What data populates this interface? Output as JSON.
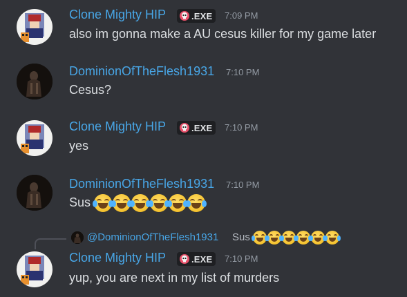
{
  "colors": {
    "background": "#313338",
    "username": "#48a6e6",
    "timestamp": "#949ba4",
    "message_text": "#dbdee1",
    "tag_background": "#1e1f22"
  },
  "messages": [
    {
      "author": "Clone Mighty HIP",
      "tag": ".EXE",
      "tag_icon": "skull-icon",
      "time": "7:09 PM",
      "text": "also im gonna make a AU cesus killer for my game later"
    },
    {
      "author": "DominionOfTheFlesh1931",
      "time": "7:10 PM",
      "text": "Cesus?"
    },
    {
      "author": "Clone Mighty HIP",
      "tag": ".EXE",
      "tag_icon": "skull-icon",
      "time": "7:10 PM",
      "text": "yes"
    },
    {
      "author": "DominionOfTheFlesh1931",
      "time": "7:10 PM",
      "text": "Sus",
      "emoji": "joy-emoji",
      "emoji_count": 6
    },
    {
      "reply_to": {
        "author": "@DominionOfTheFlesh1931",
        "text": "Sus",
        "emoji": "joy-emoji",
        "emoji_count": 6
      },
      "author": "Clone Mighty HIP",
      "tag": ".EXE",
      "tag_icon": "skull-icon",
      "time": "7:10 PM",
      "text": "yup, you are next in my list of murders"
    }
  ]
}
